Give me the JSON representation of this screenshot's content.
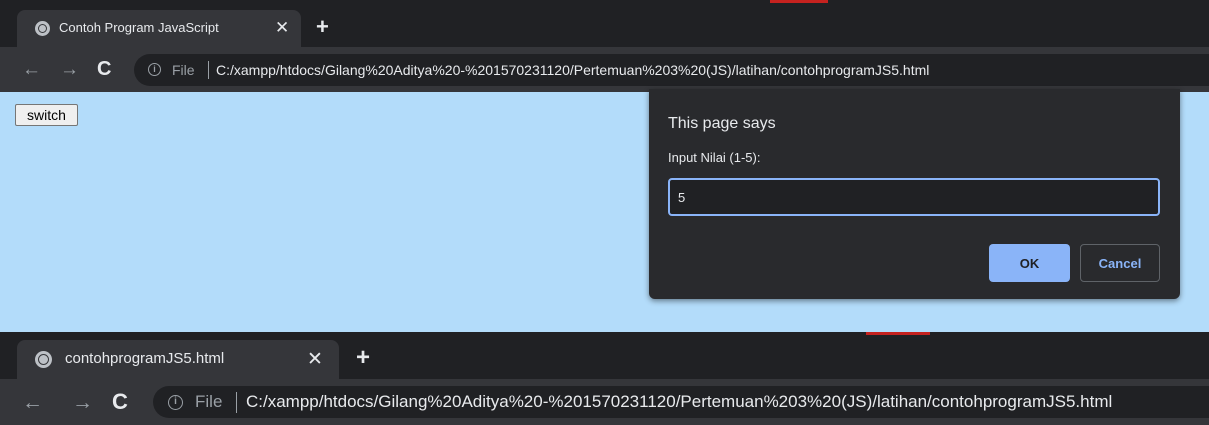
{
  "window1": {
    "tab": {
      "title": "Contoh Program JavaScript",
      "close": "✕",
      "icon": "globe-icon"
    },
    "new_tab": "+",
    "nav": {
      "back": "←",
      "forward": "→",
      "reload": "C"
    },
    "address": {
      "info": "i",
      "scheme_label": "File",
      "url": "C:/xampp/htdocs/Gilang%20Aditya%20-%201570231120/Pertemuan%203%20(JS)/latihan/contohprogramJS5.html"
    },
    "page": {
      "button_label": "switch",
      "background": "#b3dcfa"
    },
    "dialog": {
      "title": "This page says",
      "message": "Input Nilai (1-5):",
      "input_value": "5",
      "ok_label": "OK",
      "cancel_label": "Cancel"
    }
  },
  "window2": {
    "tab": {
      "title": "contohprogramJS5.html",
      "close": "✕",
      "icon": "globe-icon"
    },
    "new_tab": "+",
    "nav": {
      "back": "←",
      "forward": "→",
      "reload": "C"
    },
    "address": {
      "info": "i",
      "scheme_label": "File",
      "url": "C:/xampp/htdocs/Gilang%20Aditya%20-%201570231120/Pertemuan%203%20(JS)/latihan/contohprogramJS5.html"
    }
  },
  "colors": {
    "chrome_dark": "#202124",
    "toolbar": "#35363a",
    "accent_blue": "#8ab4f8",
    "recording_red": "#c5221f"
  }
}
